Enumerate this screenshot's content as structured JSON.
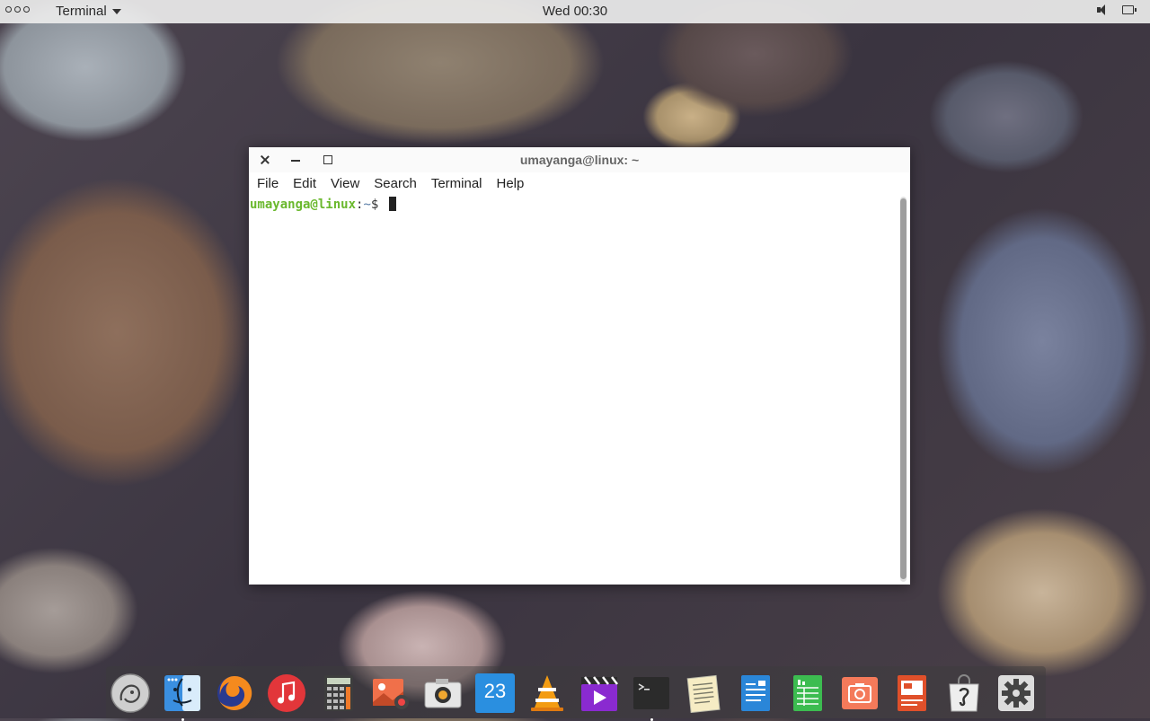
{
  "top_panel": {
    "app_menu_label": "Terminal",
    "clock": "Wed 00:30",
    "tray_icons": [
      "volume-icon",
      "battery-icon"
    ]
  },
  "window": {
    "title": "umayanga@linux: ~",
    "menu": [
      "File",
      "Edit",
      "View",
      "Search",
      "Terminal",
      "Help"
    ],
    "terminal": {
      "user_host": "umayanga@linux",
      "colon": ":",
      "path": "~",
      "symbol": "$"
    }
  },
  "dock": {
    "calendar_day": "23",
    "items": [
      {
        "name": "launcher",
        "color": "#c8c8c8"
      },
      {
        "name": "file-manager",
        "color": "#3a8fe0"
      },
      {
        "name": "firefox",
        "color": "#f58a1e"
      },
      {
        "name": "music",
        "color": "#e2363a"
      },
      {
        "name": "calculator",
        "color": "#444444"
      },
      {
        "name": "photos",
        "color": "#f0704a"
      },
      {
        "name": "camera",
        "color": "#dcdcdc"
      },
      {
        "name": "calendar",
        "color": "#2a8fe0"
      },
      {
        "name": "vlc",
        "color": "#f39c12"
      },
      {
        "name": "video-editor",
        "color": "#8a2ad0"
      },
      {
        "name": "terminal",
        "color": "#2b2b2b"
      },
      {
        "name": "text-editor",
        "color": "#f0e0a0"
      },
      {
        "name": "writer",
        "color": "#2a86d8"
      },
      {
        "name": "spreadsheet",
        "color": "#3cbc50"
      },
      {
        "name": "screenshot",
        "color": "#f47a5a"
      },
      {
        "name": "presentation",
        "color": "#e0502a"
      },
      {
        "name": "app-store",
        "color": "#e8e8e8"
      },
      {
        "name": "settings",
        "color": "#555555"
      }
    ]
  }
}
